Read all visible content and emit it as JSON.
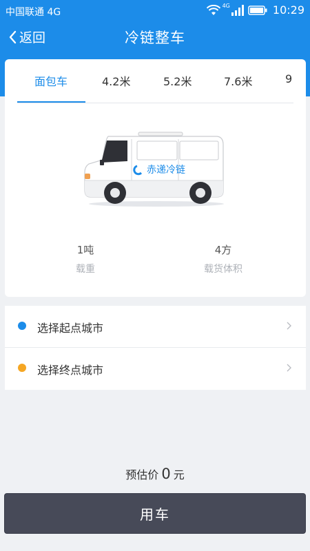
{
  "status_bar": {
    "carrier": "中国联通 4G",
    "network_badge": "4G",
    "time": "10:29",
    "icons": [
      "wifi-icon",
      "signal-icon",
      "battery-icon"
    ]
  },
  "nav": {
    "back_label": "返回",
    "title": "冷链整车",
    "back_icon": "chevron-left-icon"
  },
  "tabs": [
    {
      "label": "面包车",
      "active": true
    },
    {
      "label": "4.2米",
      "active": false
    },
    {
      "label": "5.2米",
      "active": false
    },
    {
      "label": "7.6米",
      "active": false
    },
    {
      "label": "9",
      "active": false
    }
  ],
  "vehicle": {
    "brand": "赤递冷链",
    "specs": [
      {
        "value": "1吨",
        "label": "载重"
      },
      {
        "value": "4方",
        "label": "载货体积"
      }
    ]
  },
  "route": {
    "start": {
      "label": "选择起点城市",
      "dot_color": "#1c8ce9"
    },
    "end": {
      "label": "选择终点城市",
      "dot_color": "#f5a623"
    }
  },
  "price": {
    "prefix": "预估价",
    "value": "0",
    "unit": "元"
  },
  "submit": {
    "label": "用车"
  },
  "colors": {
    "primary": "#1c8ce9",
    "button": "#474a58",
    "background": "#eff1f4"
  }
}
